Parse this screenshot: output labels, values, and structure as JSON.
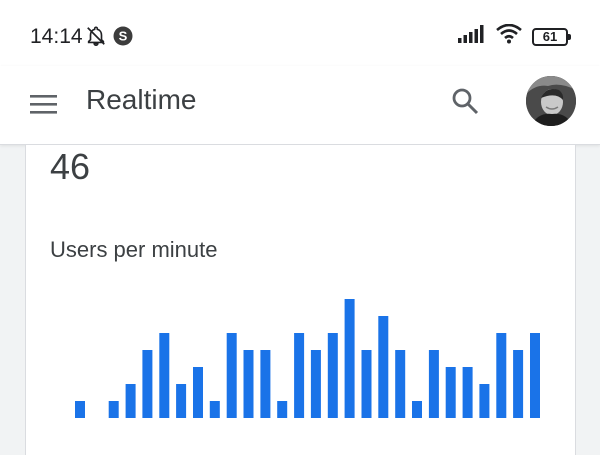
{
  "status_bar": {
    "time": "14:14",
    "icons": [
      "bell-off-icon",
      "s-app-icon",
      "signal-icon",
      "wifi-icon"
    ],
    "battery_level": "61"
  },
  "app_bar": {
    "title": "Realtime",
    "icons": [
      "menu-icon",
      "search-icon",
      "avatar"
    ]
  },
  "card": {
    "users_count": "46",
    "chart_title": "Users per minute"
  },
  "chart_data": {
    "type": "bar",
    "title": "Users per minute",
    "color": "#1a73e8",
    "values": [
      1,
      0,
      1,
      2,
      4,
      5,
      2,
      3,
      1,
      5,
      4,
      4,
      1,
      5,
      4,
      5,
      7,
      4,
      6,
      4,
      1,
      4,
      3,
      3,
      2,
      5,
      4,
      5
    ]
  }
}
